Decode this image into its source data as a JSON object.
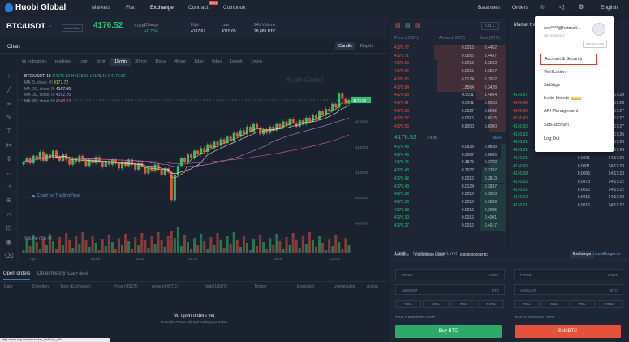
{
  "nav": {
    "logo": "Huobi Global",
    "items": [
      "Markets",
      "Fiat",
      "Exchange",
      "Contract",
      "Coinbook"
    ],
    "hot": "HOT",
    "right": {
      "balances": "Balances",
      "orders": "Orders",
      "language": "English"
    }
  },
  "ticker": {
    "pair": "BTC/USDT",
    "tag": "Huobi Main",
    "last": "4176.52",
    "usd": "≈ 0.00",
    "change_label": "Change",
    "change": "+0.75%",
    "high_label": "High",
    "high": "4187.67",
    "low_label": "Low",
    "low": "4118.65",
    "vol_label": "24h Volume",
    "vol": "28,683 BTC"
  },
  "chart": {
    "title": "Chart",
    "tabs": [
      "Candle",
      "Depth"
    ],
    "timeframes": [
      "Indicators",
      "realtime",
      "1min",
      "5min",
      "15min",
      "30min",
      "1hour",
      "4hour",
      "1day",
      "5day",
      "1week",
      "1mon"
    ],
    "active_tf": "15min",
    "legend_title": "BTC/USDT, 15",
    "ohlc": [
      "O4176.52",
      "H4178.23",
      "L4175.43",
      "C4176.52"
    ],
    "mas": [
      {
        "name": "MA (5, close, 0)",
        "value": "4177.72"
      },
      {
        "name": "MA (10, close, 0)",
        "value": "4167.09"
      },
      {
        "name": "MA (30, close, 0)",
        "value": "4152.26"
      },
      {
        "name": "MA (60, close, 0)",
        "value": "4148.53"
      }
    ],
    "vol_label": "Volume (20)",
    "vol_value": "42",
    "watermark": "Chart by TradingView",
    "price_tag": "4176.52",
    "y_ticks": [
      "4160.00",
      "4140.00",
      "4120.00",
      "4100.00",
      "4080.00"
    ],
    "x_ticks": [
      "Apr",
      "06:00",
      "12:00",
      "18:00",
      "06:00",
      "12:00"
    ],
    "watermark2": "Huobi Global"
  },
  "chart_data": {
    "type": "candlestick",
    "title": "BTC/USDT, 15",
    "ylim": [
      4070,
      4195
    ],
    "y_ticks": [
      4160,
      4140,
      4120,
      4100,
      4080
    ],
    "close": [
      4128,
      4131,
      4127,
      4133,
      4130,
      4136,
      4129,
      4134,
      4131,
      4137,
      4132,
      4129,
      4134,
      4130,
      4126,
      4131,
      4128,
      4133,
      4129,
      4125,
      4130,
      4127,
      4132,
      4128,
      4124,
      4129,
      4126,
      4130,
      4127,
      4123,
      4128,
      4125,
      4130,
      4126,
      4122,
      4127,
      4124,
      4119,
      4124,
      4121,
      4126,
      4122,
      4118,
      4123,
      4120,
      4098,
      4118,
      4125,
      4131,
      4128,
      4134,
      4131,
      4137,
      4134,
      4139,
      4136,
      4142,
      4139,
      4144,
      4141,
      4146,
      4143,
      4148,
      4145,
      4151,
      4148,
      4153,
      4150,
      4156,
      4152,
      4158,
      4155,
      4150,
      4154,
      4151,
      4156,
      4153,
      4158,
      4155,
      4160,
      4157,
      4162,
      4159,
      4156,
      4161,
      4158,
      4163,
      4160,
      4165,
      4162,
      4168,
      4165,
      4170,
      4168,
      4174,
      4171,
      4182,
      4178,
      4174,
      4177
    ]
  },
  "orders": {
    "tabs": [
      "Open orders",
      "Order history"
    ],
    "hist_note": "(Last 7 days)",
    "cols": [
      "Date",
      "Direction",
      "Type (Exchange)",
      "Price (USDT)",
      "Amount (BTC)",
      "Total (USDT)",
      "Trigger",
      "Executed",
      "Unexecuted",
      "Action"
    ],
    "empty": "No open orders yet",
    "empty_sub": "Go to the Trade tab and make your order!"
  },
  "statusbar": "https://www.hbg.com/en-us/user_center/uc_info/",
  "book": {
    "decimals": "0.01",
    "cols": [
      "Price (USDT)",
      "Amount (BTC)",
      "Sum (BTC)"
    ],
    "asks": [
      [
        "4176.72",
        "0.0015",
        "3.4452"
      ],
      [
        "4176.71",
        "0.0855",
        "3.4437"
      ],
      [
        "4176.69",
        "0.0015",
        "3.3582"
      ],
      [
        "4176.66",
        "0.0015",
        "3.3567"
      ],
      [
        "4176.65",
        "0.0124",
        "3.3552"
      ],
      [
        "4176.64",
        "1.8564",
        "3.3428"
      ],
      [
        "4176.63",
        "0.5911",
        "1.4864"
      ],
      [
        "4176.61",
        "0.0911",
        "0.8953"
      ],
      [
        "4176.60",
        "0.0027",
        "0.8042"
      ],
      [
        "4176.57",
        "0.0015",
        "0.8015"
      ],
      [
        "4176.56",
        "0.8000",
        "0.8000"
      ]
    ],
    "mid": "4176.52",
    "mid_usd": "≈ 0.00",
    "more": "More",
    "bids": [
      [
        "4176.48",
        "0.0838",
        "0.0838"
      ],
      [
        "4176.46",
        "0.0007",
        "0.0845"
      ],
      [
        "4176.45",
        "0.1875",
        "0.2720"
      ],
      [
        "4176.43",
        "0.1077",
        "0.3797"
      ],
      [
        "4176.42",
        "0.0016",
        "0.3813"
      ],
      [
        "4176.40",
        "0.0124",
        "0.3937"
      ],
      [
        "4176.39",
        "0.0016",
        "0.3953"
      ],
      [
        "4176.36",
        "0.0016",
        "0.3969"
      ],
      [
        "4176.33",
        "0.0016",
        "0.3985"
      ],
      [
        "4176.30",
        "0.0016",
        "0.4001"
      ],
      [
        "4176.27",
        "0.0016",
        "0.4017"
      ]
    ]
  },
  "trades": {
    "title": "Market trades",
    "cols": [
      "Price",
      "Amount",
      "Time"
    ],
    "rows": [
      [
        "4176.52",
        "0.0012",
        "14:17:29"
      ],
      [
        "4176.61",
        "0.0012",
        "14:17:29"
      ],
      [
        "4176.61",
        "0.0012",
        "14:17:29"
      ],
      [
        "4176.58",
        "0.0012",
        "14:17:28"
      ],
      [
        "4176.60",
        "0.0012",
        "14:17:28"
      ],
      [
        "4176.61",
        "0.0012",
        "14:17:28"
      ],
      [
        "4176.57",
        "0.0012",
        "14:17:28"
      ],
      [
        "4176.48",
        "0.0012",
        "14:17:28"
      ],
      [
        "4176.45",
        "0.0012",
        "14:17:27"
      ],
      [
        "4176.43",
        "0.0012",
        "14:17:27"
      ],
      [
        "4176.50",
        "0.0012",
        "14:17:27"
      ],
      [
        "4176.62",
        "0.0989",
        "14:17:26"
      ],
      [
        "4176.61",
        "0.0989",
        "14:17:26"
      ],
      [
        "4176.61",
        "0.0168",
        "14:17:24"
      ],
      [
        "4176.61",
        "0.0001",
        "14:17:23"
      ],
      [
        "4176.60",
        "0.0001",
        "14:17:23"
      ],
      [
        "4176.58",
        "0.0095",
        "14:17:23"
      ],
      [
        "4176.62",
        "0.0873",
        "14:17:22"
      ],
      [
        "4176.61",
        "0.0012",
        "14:17:22"
      ],
      [
        "4176.62",
        "0.0016",
        "14:17:22"
      ],
      [
        "4176.61",
        "0.0016",
        "14:17:22"
      ]
    ]
  },
  "balances": {
    "available": "Available",
    "usdt": "0.00000000 USDT",
    "btc": "0.00000000 BTC",
    "exchange": "Exchange",
    "margin": "Margin"
  },
  "form": {
    "tabs": [
      "Limit",
      "Market",
      "Stop-Limit"
    ],
    "deposit": "Deposit",
    "fee": "Fee",
    "price": "PRICE",
    "amount": "AMOUNT",
    "usdt": "USDT",
    "btc": "BTC",
    "pcts": [
      "25%",
      "50%",
      "75%",
      "100%"
    ],
    "total_buy": "Total: 0.00000000 USDT",
    "total_sell": "Total: 0.00000000 USDT",
    "buy": "Buy BTC",
    "sell": "Sell BTC"
  },
  "dropdown": {
    "email": "seb****@hotmail...",
    "uid": "UID 93404347",
    "vip": "What's VIP",
    "items": [
      "Account & Security",
      "Verification",
      "Settings",
      "Invite friends",
      "API Management",
      "Sub-account",
      "Log Out"
    ],
    "badge": "Rebate"
  }
}
